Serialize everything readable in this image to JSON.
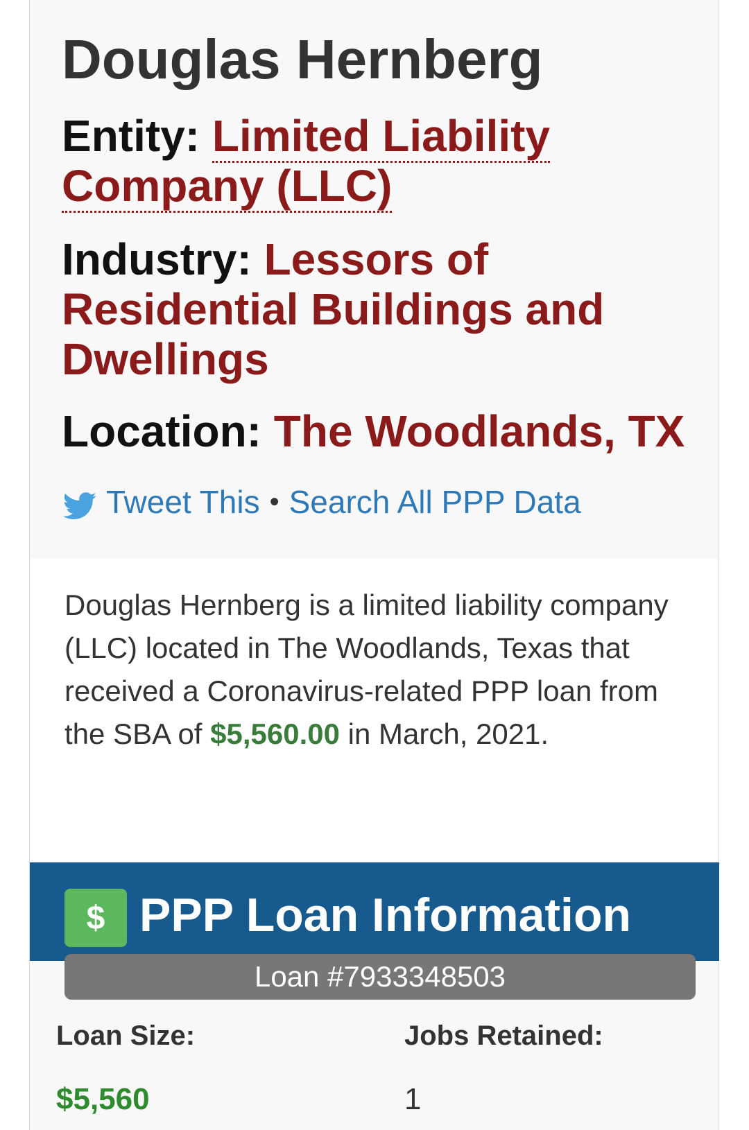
{
  "business": {
    "name": "Douglas Hernberg",
    "entity_label": "Entity:",
    "entity_value": "Limited Liability Company (LLC)",
    "industry_label": "Industry:",
    "industry_value": "Lessors of Residential Buildings and Dwellings",
    "location_label": "Location:",
    "location_value": "The Woodlands, TX"
  },
  "share": {
    "tweet_label": "Tweet This",
    "separator": "•",
    "search_label": "Search All PPP Data",
    "icon": "twitter-bird-icon"
  },
  "description": {
    "part1": "Douglas Hernberg is a limited liability company (LLC) located in The Woodlands, Texas that received a Coronavirus-related PPP loan from the SBA of ",
    "amount": "$5,560.00",
    "part2": " in March, 2021."
  },
  "loan_section": {
    "icon_symbol": "$",
    "icon": "dollar-icon",
    "title": "PPP Loan Information",
    "loan_number": "Loan #7933348503",
    "loan_size_label": "Loan Size:",
    "loan_size_value": "$5,560",
    "jobs_label": "Jobs Retained:",
    "jobs_value": "1"
  },
  "colors": {
    "accent_red": "#8b1a1a",
    "link_blue": "#2e7ab8",
    "header_blue": "#175a8e",
    "money_green": "#2e8b2e",
    "badge_green": "#5cb85c"
  }
}
